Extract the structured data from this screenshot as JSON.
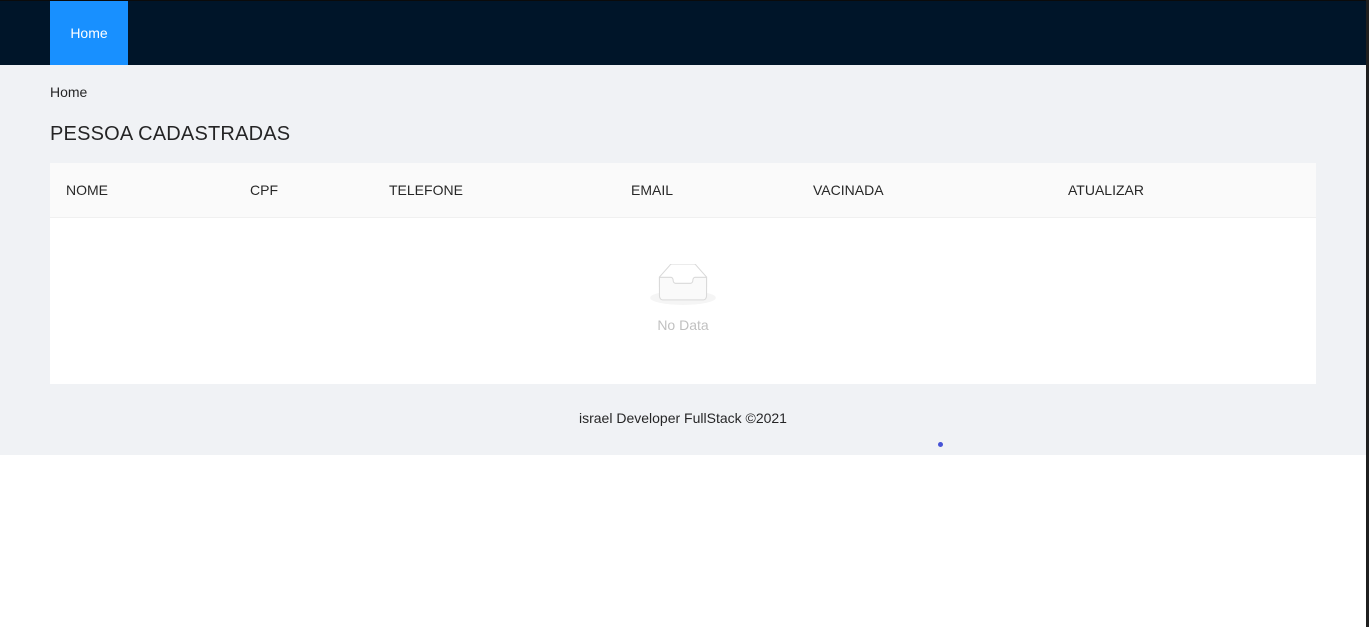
{
  "header": {
    "nav_items": [
      {
        "label": "Home",
        "active": true
      }
    ],
    "bg_color": "#001529",
    "active_color": "#1890ff"
  },
  "breadcrumb": {
    "items": [
      "Home"
    ]
  },
  "page": {
    "title": "PESSOA CADASTRADAS"
  },
  "table": {
    "columns": [
      "NOME",
      "CPF",
      "TELEFONE",
      "EMAIL",
      "VACINADA",
      "ATUALIZAR"
    ],
    "rows": [],
    "empty_text": "No Data",
    "empty_icon": "inbox-icon"
  },
  "footer": {
    "text": "israel Developer FullStack ©2021"
  },
  "colors": {
    "layout_bg": "#f0f2f5",
    "loading_dot": "#4653d6"
  }
}
